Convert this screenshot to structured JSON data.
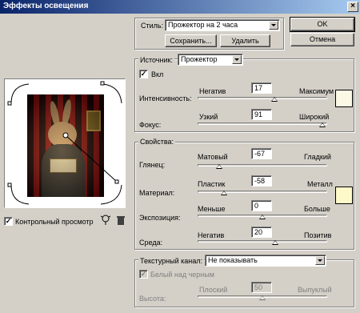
{
  "window": {
    "title": "Эффекты освещения",
    "close_glyph": "×"
  },
  "style_row": {
    "label": "Стиль:",
    "value": "Прожектор на 2 часа"
  },
  "buttons": {
    "save": "Сохранить...",
    "delete": "Удалить",
    "ok": "OK",
    "cancel": "Отмена"
  },
  "source": {
    "label": "Источник:",
    "value": "Прожектор",
    "on_label": "Вкл",
    "on_checked": true
  },
  "intensity": {
    "label": "Интенсивность:",
    "min_label": "Негатив",
    "max_label": "Максимум",
    "value": "17",
    "fraction": 0.59
  },
  "focus": {
    "label": "Фокус:",
    "min_label": "Узкий",
    "max_label": "Широкий",
    "value": "91",
    "fraction": 0.96
  },
  "light_color": "#fbf9e6",
  "properties": {
    "group_label": "Свойства:",
    "gloss": {
      "label": "Глянец:",
      "min_label": "Матовый",
      "max_label": "Гладкий",
      "value": "-67",
      "fraction": 0.17
    },
    "material": {
      "label": "Материал:",
      "min_label": "Пластик",
      "max_label": "Металл",
      "value": "-58",
      "fraction": 0.21
    },
    "exposure": {
      "label": "Экспозиция:",
      "min_label": "Меньше",
      "max_label": "Больше",
      "value": "0",
      "fraction": 0.5
    },
    "ambience": {
      "label": "Среда:",
      "min_label": "Негатив",
      "max_label": "Позитив",
      "value": "20",
      "fraction": 0.6
    },
    "color": "#fdf9c8"
  },
  "texture": {
    "label": "Текстурный канал:",
    "value": "Не показывать",
    "white_high_label": "Белый над черным",
    "height_label": "Высота:",
    "min_label": "Плоский",
    "max_label": "Выпуклый",
    "value_height": "50",
    "fraction": 0.5
  },
  "preview": {
    "label": "Контрольный просмотр",
    "checked": true
  },
  "icons": {
    "light_bulb": "light-bulb-icon",
    "trash": "trash-icon"
  }
}
